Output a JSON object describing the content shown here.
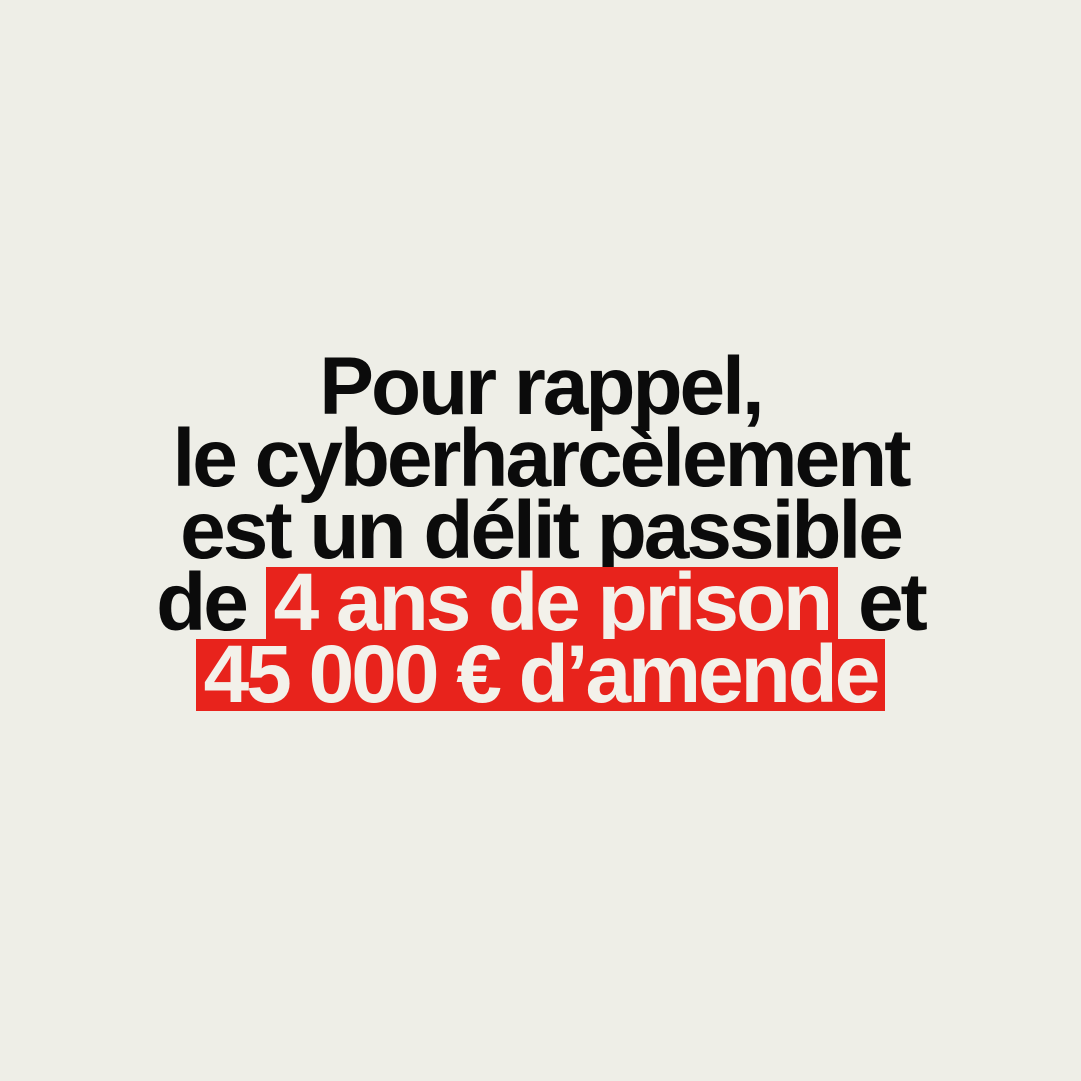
{
  "colors": {
    "background": "#eeeee7",
    "text": "#0b0b0b",
    "highlight": "#e8231c",
    "highlight_text": "#f3f1ea"
  },
  "message": {
    "line1": "Pour rappel,",
    "line2": "le cyberharcèlement",
    "line3": "est un délit passible",
    "line4_start": "de",
    "line4_highlight": "4 ans de prison",
    "line4_end": "et",
    "line5_highlight": "45 000 € d’amende"
  }
}
